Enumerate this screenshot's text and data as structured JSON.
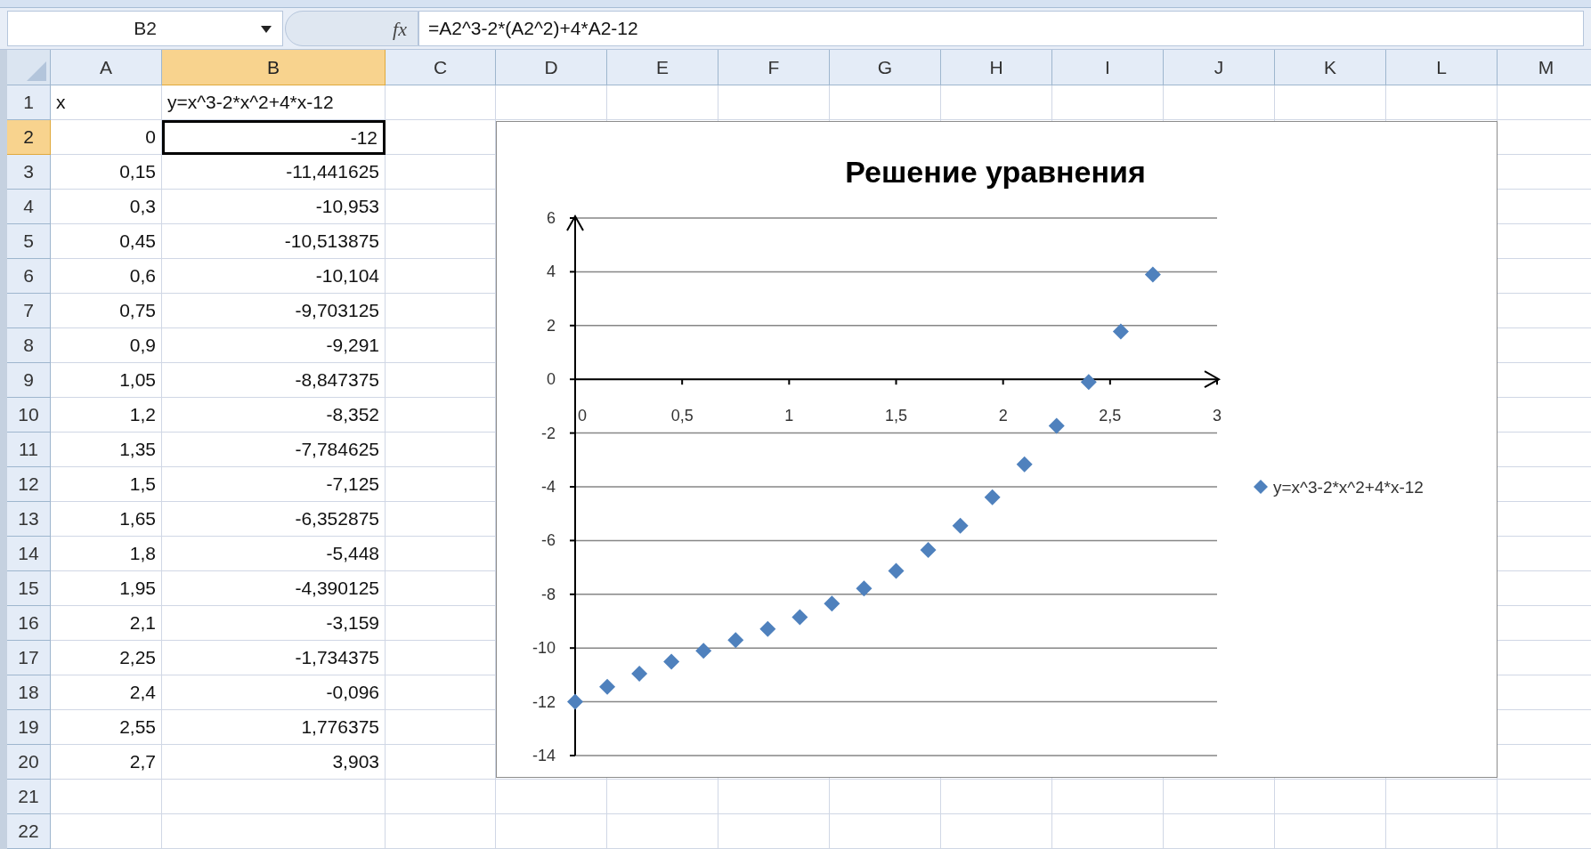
{
  "formula_bar": {
    "name_box": "B2",
    "function_label": "fx",
    "formula": "=A2^3-2*(A2^2)+4*A2-12"
  },
  "columns": [
    {
      "label": "A",
      "selected": false
    },
    {
      "label": "B",
      "selected": true
    },
    {
      "label": "C",
      "selected": false
    },
    {
      "label": "D",
      "selected": false
    },
    {
      "label": "E",
      "selected": false
    },
    {
      "label": "F",
      "selected": false
    },
    {
      "label": "G",
      "selected": false
    },
    {
      "label": "H",
      "selected": false
    },
    {
      "label": "I",
      "selected": false
    },
    {
      "label": "J",
      "selected": false
    },
    {
      "label": "K",
      "selected": false
    },
    {
      "label": "L",
      "selected": false
    },
    {
      "label": "M",
      "selected": false
    }
  ],
  "rows": [
    {
      "header": "1",
      "selected": false,
      "cells": [
        {
          "text": "x",
          "kind": "text",
          "selected": false
        },
        {
          "text": "y=x^3-2*x^2+4*x-12",
          "kind": "text",
          "selected": false
        }
      ]
    },
    {
      "header": "2",
      "selected": true,
      "cells": [
        {
          "text": "0",
          "kind": "number",
          "selected": false
        },
        {
          "text": "-12",
          "kind": "number",
          "selected": true
        }
      ]
    },
    {
      "header": "3",
      "selected": false,
      "cells": [
        {
          "text": "0,15",
          "kind": "number",
          "selected": false
        },
        {
          "text": "-11,441625",
          "kind": "number",
          "selected": false
        }
      ]
    },
    {
      "header": "4",
      "selected": false,
      "cells": [
        {
          "text": "0,3",
          "kind": "number",
          "selected": false
        },
        {
          "text": "-10,953",
          "kind": "number",
          "selected": false
        }
      ]
    },
    {
      "header": "5",
      "selected": false,
      "cells": [
        {
          "text": "0,45",
          "kind": "number",
          "selected": false
        },
        {
          "text": "-10,513875",
          "kind": "number",
          "selected": false
        }
      ]
    },
    {
      "header": "6",
      "selected": false,
      "cells": [
        {
          "text": "0,6",
          "kind": "number",
          "selected": false
        },
        {
          "text": "-10,104",
          "kind": "number",
          "selected": false
        }
      ]
    },
    {
      "header": "7",
      "selected": false,
      "cells": [
        {
          "text": "0,75",
          "kind": "number",
          "selected": false
        },
        {
          "text": "-9,703125",
          "kind": "number",
          "selected": false
        }
      ]
    },
    {
      "header": "8",
      "selected": false,
      "cells": [
        {
          "text": "0,9",
          "kind": "number",
          "selected": false
        },
        {
          "text": "-9,291",
          "kind": "number",
          "selected": false
        }
      ]
    },
    {
      "header": "9",
      "selected": false,
      "cells": [
        {
          "text": "1,05",
          "kind": "number",
          "selected": false
        },
        {
          "text": "-8,847375",
          "kind": "number",
          "selected": false
        }
      ]
    },
    {
      "header": "10",
      "selected": false,
      "cells": [
        {
          "text": "1,2",
          "kind": "number",
          "selected": false
        },
        {
          "text": "-8,352",
          "kind": "number",
          "selected": false
        }
      ]
    },
    {
      "header": "11",
      "selected": false,
      "cells": [
        {
          "text": "1,35",
          "kind": "number",
          "selected": false
        },
        {
          "text": "-7,784625",
          "kind": "number",
          "selected": false
        }
      ]
    },
    {
      "header": "12",
      "selected": false,
      "cells": [
        {
          "text": "1,5",
          "kind": "number",
          "selected": false
        },
        {
          "text": "-7,125",
          "kind": "number",
          "selected": false
        }
      ]
    },
    {
      "header": "13",
      "selected": false,
      "cells": [
        {
          "text": "1,65",
          "kind": "number",
          "selected": false
        },
        {
          "text": "-6,352875",
          "kind": "number",
          "selected": false
        }
      ]
    },
    {
      "header": "14",
      "selected": false,
      "cells": [
        {
          "text": "1,8",
          "kind": "number",
          "selected": false
        },
        {
          "text": "-5,448",
          "kind": "number",
          "selected": false
        }
      ]
    },
    {
      "header": "15",
      "selected": false,
      "cells": [
        {
          "text": "1,95",
          "kind": "number",
          "selected": false
        },
        {
          "text": "-4,390125",
          "kind": "number",
          "selected": false
        }
      ]
    },
    {
      "header": "16",
      "selected": false,
      "cells": [
        {
          "text": "2,1",
          "kind": "number",
          "selected": false
        },
        {
          "text": "-3,159",
          "kind": "number",
          "selected": false
        }
      ]
    },
    {
      "header": "17",
      "selected": false,
      "cells": [
        {
          "text": "2,25",
          "kind": "number",
          "selected": false
        },
        {
          "text": "-1,734375",
          "kind": "number",
          "selected": false
        }
      ]
    },
    {
      "header": "18",
      "selected": false,
      "cells": [
        {
          "text": "2,4",
          "kind": "number",
          "selected": false
        },
        {
          "text": "-0,096",
          "kind": "number",
          "selected": false
        }
      ]
    },
    {
      "header": "19",
      "selected": false,
      "cells": [
        {
          "text": "2,55",
          "kind": "number",
          "selected": false
        },
        {
          "text": "1,776375",
          "kind": "number",
          "selected": false
        }
      ]
    },
    {
      "header": "20",
      "selected": false,
      "cells": [
        {
          "text": "2,7",
          "kind": "number",
          "selected": false
        },
        {
          "text": "3,903",
          "kind": "number",
          "selected": false
        }
      ]
    },
    {
      "header": "21",
      "selected": false,
      "cells": []
    },
    {
      "header": "22",
      "selected": false,
      "cells": []
    }
  ],
  "chart": {
    "chart_data": {
      "type": "scatter",
      "title": "Решение уравнения",
      "x": [
        0,
        0.15,
        0.3,
        0.45,
        0.6,
        0.75,
        0.9,
        1.05,
        1.2,
        1.35,
        1.5,
        1.65,
        1.8,
        1.95,
        2.1,
        2.25,
        2.4,
        2.55,
        2.7
      ],
      "series": [
        {
          "name": "y=x^3-2*x^2+4*x-12",
          "color": "#4f81bd",
          "values": [
            -12,
            -11.44,
            -10.95,
            -10.51,
            -10.1,
            -9.7,
            -9.29,
            -8.85,
            -8.35,
            -7.78,
            -7.13,
            -6.35,
            -5.45,
            -4.39,
            -3.16,
            -1.73,
            -0.1,
            1.78,
            3.9
          ]
        }
      ],
      "grid": true,
      "xlim": [
        0,
        3
      ],
      "ylim": [
        -14,
        6
      ],
      "xticks": [
        0,
        {
          "value": 0.5,
          "label": "0,5"
        },
        1,
        {
          "value": 1.5,
          "label": "1,5"
        },
        2,
        {
          "value": 2.5,
          "label": "2,5"
        },
        3
      ],
      "yticks": [
        -14,
        -12,
        -10,
        -8,
        -6,
        -4,
        -2,
        0,
        2,
        4,
        6
      ]
    }
  }
}
